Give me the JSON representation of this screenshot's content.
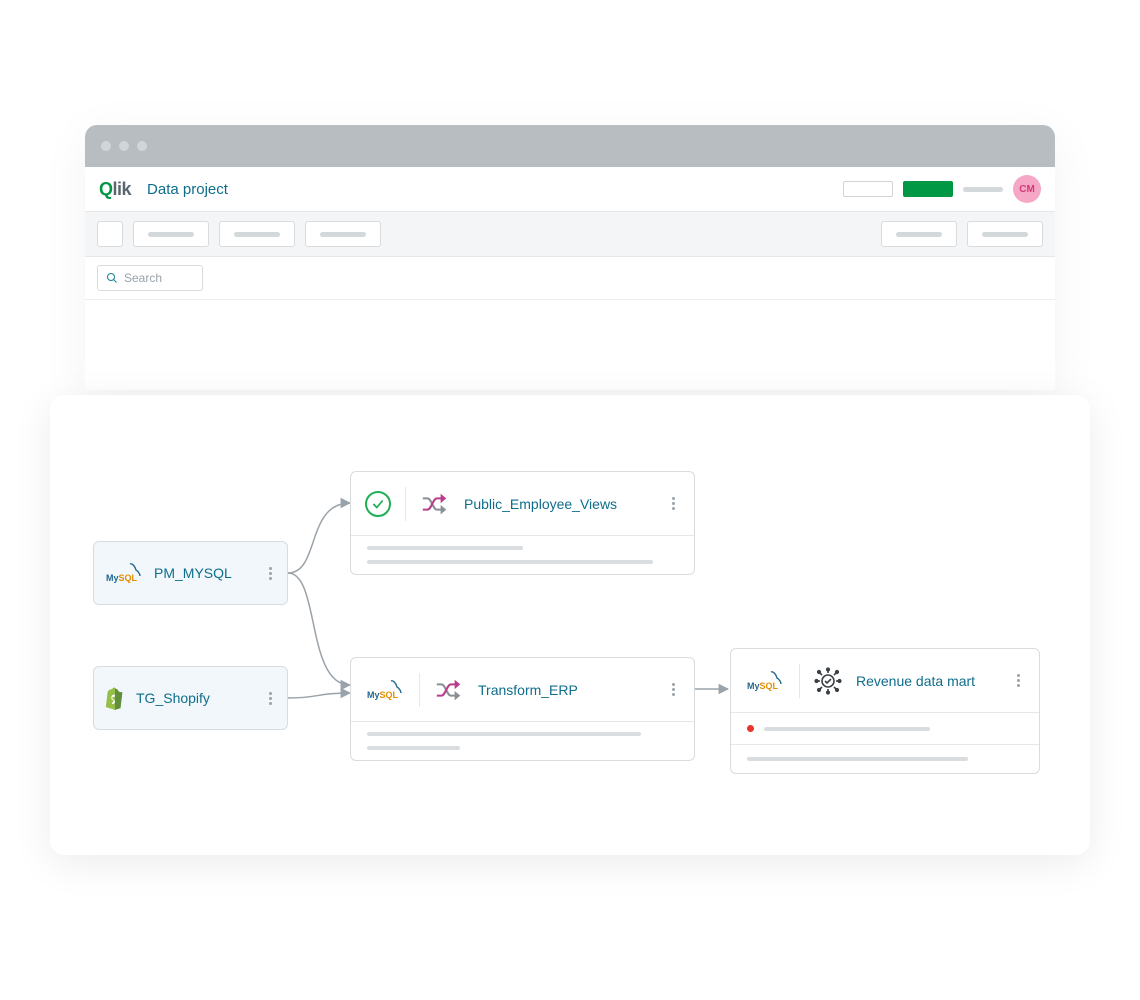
{
  "header": {
    "logo_q": "Q",
    "logo_lik": "lik",
    "title": "Data project",
    "avatar_initials": "CM"
  },
  "search": {
    "placeholder": "Search"
  },
  "sources": [
    {
      "label": "PM_MYSQL",
      "icon": "mysql"
    },
    {
      "label": "TG_Shopify",
      "icon": "shopify"
    }
  ],
  "transforms": [
    {
      "label": "Public_Employee_Views",
      "status": "check"
    },
    {
      "label": "Transform_ERP",
      "status": "mysql"
    }
  ],
  "mart": {
    "label": "Revenue data mart"
  }
}
